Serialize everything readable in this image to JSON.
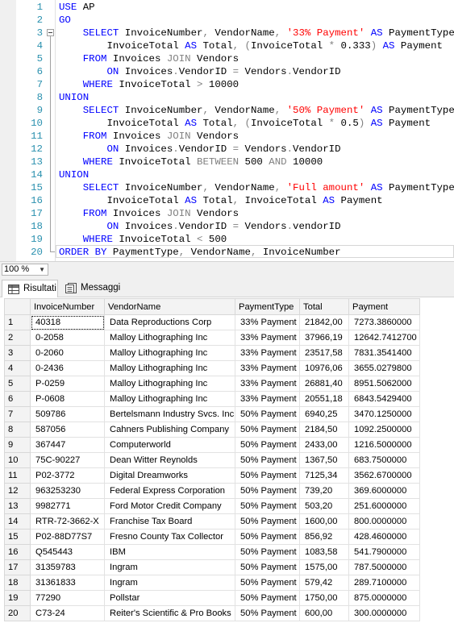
{
  "editor": {
    "lines": [
      {
        "n": "1",
        "tokens": [
          [
            "kw",
            "USE"
          ],
          [
            "t",
            " AP"
          ]
        ]
      },
      {
        "n": "2",
        "tokens": [
          [
            "kw",
            "GO"
          ]
        ]
      },
      {
        "n": "3",
        "tokens": [
          [
            "t",
            "    "
          ],
          [
            "kw",
            "SELECT"
          ],
          [
            "t",
            " InvoiceNumber"
          ],
          [
            "op",
            ","
          ],
          [
            "t",
            " VendorName"
          ],
          [
            "op",
            ","
          ],
          [
            "t",
            " "
          ],
          [
            "str",
            "'33% Payment'"
          ],
          [
            "t",
            " "
          ],
          [
            "kw",
            "AS"
          ],
          [
            "t",
            " PaymentType"
          ],
          [
            "op",
            ","
          ]
        ]
      },
      {
        "n": "4",
        "tokens": [
          [
            "t",
            "        InvoiceTotal "
          ],
          [
            "kw",
            "AS"
          ],
          [
            "t",
            " Total"
          ],
          [
            "op",
            ","
          ],
          [
            "t",
            " "
          ],
          [
            "op",
            "("
          ],
          [
            "t",
            "InvoiceTotal "
          ],
          [
            "op",
            "*"
          ],
          [
            "t",
            " 0.333"
          ],
          [
            "op",
            ")"
          ],
          [
            "t",
            " "
          ],
          [
            "kw",
            "AS"
          ],
          [
            "t",
            " Payment"
          ]
        ]
      },
      {
        "n": "5",
        "tokens": [
          [
            "t",
            "    "
          ],
          [
            "kw",
            "FROM"
          ],
          [
            "t",
            " Invoices "
          ],
          [
            "op",
            "JOIN"
          ],
          [
            "t",
            " Vendors"
          ]
        ]
      },
      {
        "n": "6",
        "tokens": [
          [
            "t",
            "        "
          ],
          [
            "kw",
            "ON"
          ],
          [
            "t",
            " Invoices"
          ],
          [
            "op",
            "."
          ],
          [
            "t",
            "VendorID "
          ],
          [
            "op",
            "="
          ],
          [
            "t",
            " Vendors"
          ],
          [
            "op",
            "."
          ],
          [
            "t",
            "VendorID"
          ]
        ]
      },
      {
        "n": "7",
        "tokens": [
          [
            "t",
            "    "
          ],
          [
            "kw",
            "WHERE"
          ],
          [
            "t",
            " InvoiceTotal "
          ],
          [
            "op",
            ">"
          ],
          [
            "t",
            " 10000"
          ]
        ]
      },
      {
        "n": "8",
        "tokens": [
          [
            "kw",
            "UNION"
          ]
        ]
      },
      {
        "n": "9",
        "tokens": [
          [
            "t",
            "    "
          ],
          [
            "kw",
            "SELECT"
          ],
          [
            "t",
            " InvoiceNumber"
          ],
          [
            "op",
            ","
          ],
          [
            "t",
            " VendorName"
          ],
          [
            "op",
            ","
          ],
          [
            "t",
            " "
          ],
          [
            "str",
            "'50% Payment'"
          ],
          [
            "t",
            " "
          ],
          [
            "kw",
            "AS"
          ],
          [
            "t",
            " PaymentType"
          ],
          [
            "op",
            ","
          ]
        ]
      },
      {
        "n": "10",
        "tokens": [
          [
            "t",
            "        InvoiceTotal "
          ],
          [
            "kw",
            "AS"
          ],
          [
            "t",
            " Total"
          ],
          [
            "op",
            ","
          ],
          [
            "t",
            " "
          ],
          [
            "op",
            "("
          ],
          [
            "t",
            "InvoiceTotal "
          ],
          [
            "op",
            "*"
          ],
          [
            "t",
            " 0.5"
          ],
          [
            "op",
            ")"
          ],
          [
            "t",
            " "
          ],
          [
            "kw",
            "AS"
          ],
          [
            "t",
            " Payment"
          ]
        ]
      },
      {
        "n": "11",
        "tokens": [
          [
            "t",
            "    "
          ],
          [
            "kw",
            "FROM"
          ],
          [
            "t",
            " Invoices "
          ],
          [
            "op",
            "JOIN"
          ],
          [
            "t",
            " Vendors"
          ]
        ]
      },
      {
        "n": "12",
        "tokens": [
          [
            "t",
            "        "
          ],
          [
            "kw",
            "ON"
          ],
          [
            "t",
            " Invoices"
          ],
          [
            "op",
            "."
          ],
          [
            "t",
            "VendorID "
          ],
          [
            "op",
            "="
          ],
          [
            "t",
            " Vendors"
          ],
          [
            "op",
            "."
          ],
          [
            "t",
            "VendorID"
          ]
        ]
      },
      {
        "n": "13",
        "tokens": [
          [
            "t",
            "    "
          ],
          [
            "kw",
            "WHERE"
          ],
          [
            "t",
            " InvoiceTotal "
          ],
          [
            "op",
            "BETWEEN"
          ],
          [
            "t",
            " 500 "
          ],
          [
            "op",
            "AND"
          ],
          [
            "t",
            " 10000"
          ]
        ]
      },
      {
        "n": "14",
        "tokens": [
          [
            "kw",
            "UNION"
          ]
        ]
      },
      {
        "n": "15",
        "tokens": [
          [
            "t",
            "    "
          ],
          [
            "kw",
            "SELECT"
          ],
          [
            "t",
            " InvoiceNumber"
          ],
          [
            "op",
            ","
          ],
          [
            "t",
            " VendorName"
          ],
          [
            "op",
            ","
          ],
          [
            "t",
            " "
          ],
          [
            "str",
            "'Full amount'"
          ],
          [
            "t",
            " "
          ],
          [
            "kw",
            "AS"
          ],
          [
            "t",
            " PaymentType"
          ],
          [
            "op",
            ","
          ]
        ]
      },
      {
        "n": "16",
        "tokens": [
          [
            "t",
            "        InvoiceTotal "
          ],
          [
            "kw",
            "AS"
          ],
          [
            "t",
            " Total"
          ],
          [
            "op",
            ","
          ],
          [
            "t",
            " InvoiceTotal "
          ],
          [
            "kw",
            "AS"
          ],
          [
            "t",
            " Payment"
          ]
        ]
      },
      {
        "n": "17",
        "tokens": [
          [
            "t",
            "    "
          ],
          [
            "kw",
            "FROM"
          ],
          [
            "t",
            " Invoices "
          ],
          [
            "op",
            "JOIN"
          ],
          [
            "t",
            " Vendors"
          ]
        ]
      },
      {
        "n": "18",
        "tokens": [
          [
            "t",
            "        "
          ],
          [
            "kw",
            "ON"
          ],
          [
            "t",
            " Invoices"
          ],
          [
            "op",
            "."
          ],
          [
            "t",
            "VendorID "
          ],
          [
            "op",
            "="
          ],
          [
            "t",
            " Vendors"
          ],
          [
            "op",
            "."
          ],
          [
            "t",
            "vendorID"
          ]
        ]
      },
      {
        "n": "19",
        "tokens": [
          [
            "t",
            "    "
          ],
          [
            "kw",
            "WHERE"
          ],
          [
            "t",
            " InvoiceTotal "
          ],
          [
            "op",
            "<"
          ],
          [
            "t",
            " 500"
          ]
        ]
      },
      {
        "n": "20",
        "tokens": [
          [
            "kw",
            "ORDER BY"
          ],
          [
            "t",
            " PaymentType"
          ],
          [
            "op",
            ","
          ],
          [
            "t",
            " VendorName"
          ],
          [
            "op",
            ","
          ],
          [
            "t",
            " InvoiceNumber"
          ]
        ]
      }
    ]
  },
  "zoom": {
    "value": "100 %"
  },
  "tabs": {
    "results": "Risultati",
    "messages": "Messaggi"
  },
  "grid": {
    "columns": [
      "InvoiceNumber",
      "VendorName",
      "PaymentType",
      "Total",
      "Payment"
    ],
    "rows": [
      [
        "1",
        "40318",
        "Data Reproductions Corp",
        "33% Payment",
        "21842,00",
        "7273.3860000"
      ],
      [
        "2",
        "0-2058",
        "Malloy Lithographing Inc",
        "33% Payment",
        "37966,19",
        "12642.7412700"
      ],
      [
        "3",
        "0-2060",
        "Malloy Lithographing Inc",
        "33% Payment",
        "23517,58",
        "7831.3541400"
      ],
      [
        "4",
        "0-2436",
        "Malloy Lithographing Inc",
        "33% Payment",
        "10976,06",
        "3655.0279800"
      ],
      [
        "5",
        "P-0259",
        "Malloy Lithographing Inc",
        "33% Payment",
        "26881,40",
        "8951.5062000"
      ],
      [
        "6",
        "P-0608",
        "Malloy Lithographing Inc",
        "33% Payment",
        "20551,18",
        "6843.5429400"
      ],
      [
        "7",
        "509786",
        "Bertelsmann Industry Svcs. Inc",
        "50% Payment",
        "6940,25",
        "3470.1250000"
      ],
      [
        "8",
        "587056",
        "Cahners Publishing Company",
        "50% Payment",
        "2184,50",
        "1092.2500000"
      ],
      [
        "9",
        "367447",
        "Computerworld",
        "50% Payment",
        "2433,00",
        "1216.5000000"
      ],
      [
        "10",
        "75C-90227",
        "Dean Witter Reynolds",
        "50% Payment",
        "1367,50",
        "683.7500000"
      ],
      [
        "11",
        "P02-3772",
        "Digital Dreamworks",
        "50% Payment",
        "7125,34",
        "3562.6700000"
      ],
      [
        "12",
        "963253230",
        "Federal Express Corporation",
        "50% Payment",
        "739,20",
        "369.6000000"
      ],
      [
        "13",
        "9982771",
        "Ford Motor Credit Company",
        "50% Payment",
        "503,20",
        "251.6000000"
      ],
      [
        "14",
        "RTR-72-3662-X",
        "Franchise Tax Board",
        "50% Payment",
        "1600,00",
        "800.0000000"
      ],
      [
        "15",
        "P02-88D77S7",
        "Fresno County Tax Collector",
        "50% Payment",
        "856,92",
        "428.4600000"
      ],
      [
        "16",
        "Q545443",
        "IBM",
        "50% Payment",
        "1083,58",
        "541.7900000"
      ],
      [
        "17",
        "31359783",
        "Ingram",
        "50% Payment",
        "1575,00",
        "787.5000000"
      ],
      [
        "18",
        "31361833",
        "Ingram",
        "50% Payment",
        "579,42",
        "289.7100000"
      ],
      [
        "19",
        "77290",
        "Pollstar",
        "50% Payment",
        "1750,00",
        "875.0000000"
      ],
      [
        "20",
        "C73-24",
        "Reiter's Scientific & Pro Books",
        "50% Payment",
        "600,00",
        "300.0000000"
      ]
    ]
  }
}
